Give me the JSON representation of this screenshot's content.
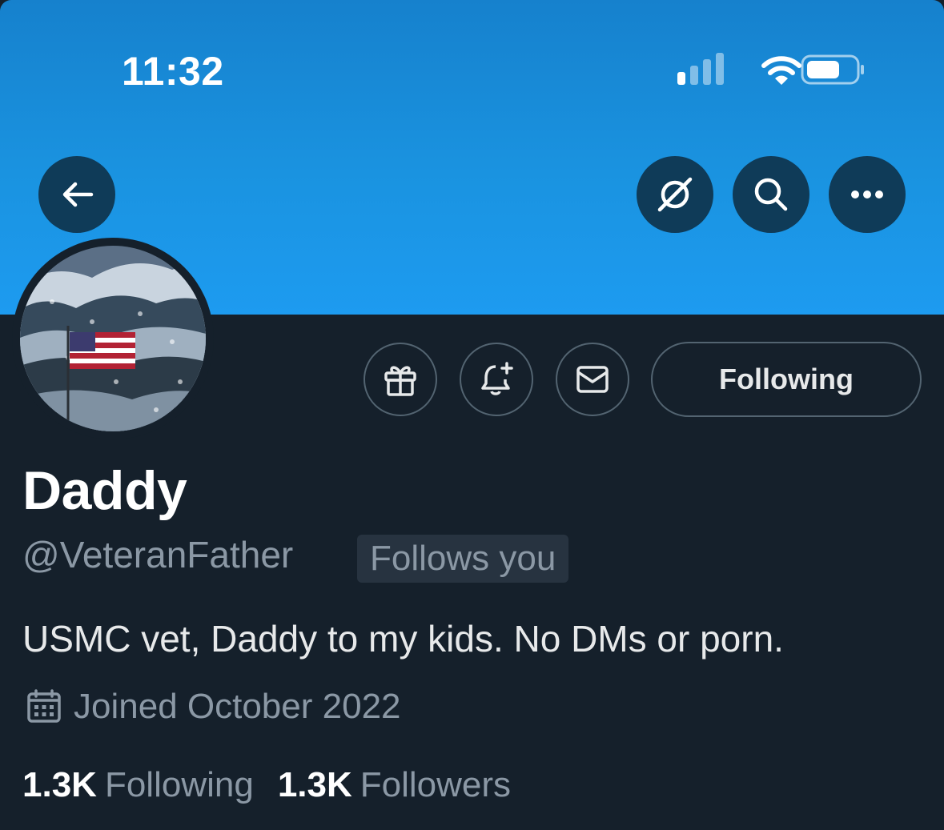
{
  "status_bar": {
    "time": "11:32",
    "icons": [
      "cellular-signal-icon",
      "wifi-icon",
      "battery-icon"
    ]
  },
  "header_actions": {
    "left": [
      "back-arrow-icon"
    ],
    "right": [
      "grok-icon",
      "search-icon",
      "more-icon"
    ]
  },
  "profile": {
    "display_name": "Daddy",
    "handle": "@VeteranFather",
    "follows_you_badge": "Follows you",
    "bio": "USMC vet, Daddy to my kids. No DMs or porn.",
    "joined": "Joined October 2022",
    "following_count": "1.3K",
    "following_label": "Following",
    "followers_count": "1.3K",
    "followers_label": "Followers"
  },
  "actions": {
    "icons": [
      "gift-icon",
      "notification-bell-plus-icon",
      "message-envelope-icon"
    ],
    "following_button_label": "Following"
  },
  "colors": {
    "banner": "#1d9bf0",
    "background": "#15202b",
    "secondary_text": "#8b98a5",
    "border": "#536471"
  }
}
